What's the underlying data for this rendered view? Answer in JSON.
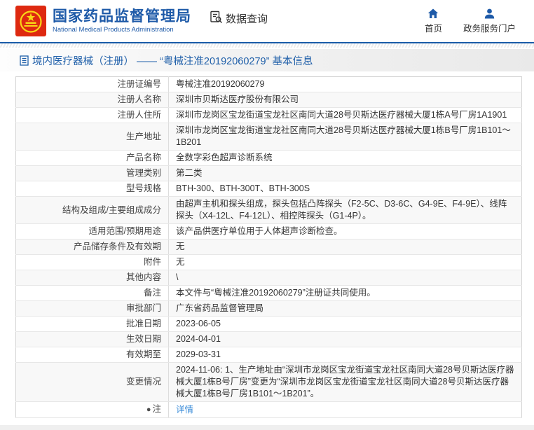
{
  "header": {
    "agency_name_zh": "国家药品监督管理局",
    "agency_name_en": "National Medical Products Administration",
    "data_query_label": "数据查询",
    "nav_home": "首页",
    "nav_portal": "政务服务门户"
  },
  "page_title": "境内医疗器械（注册） —— “粤械注准20192060279” 基本信息",
  "colors": {
    "brand_blue": "#1e5aa8",
    "link_blue": "#3c8dd9",
    "logo_red": "#de2910",
    "logo_gold": "#f9d616"
  },
  "table": {
    "rows": [
      {
        "label": "注册证编号",
        "value": "粤械注准20192060279"
      },
      {
        "label": "注册人名称",
        "value": "深圳市贝斯达医疗股份有限公司"
      },
      {
        "label": "注册人住所",
        "value": "深圳市龙岗区宝龙街道宝龙社区南同大道28号贝斯达医疗器械大厦1栋A号厂房1A1901"
      },
      {
        "label": "生产地址",
        "value": "深圳市龙岗区宝龙街道宝龙社区南同大道28号贝斯达医疗器械大厦1栋B号厂房1B101～1B201"
      },
      {
        "label": "产品名称",
        "value": "全数字彩色超声诊断系统"
      },
      {
        "label": "管理类别",
        "value": "第二类"
      },
      {
        "label": "型号规格",
        "value": "BTH-300、BTH-300T、BTH-300S"
      },
      {
        "label": "结构及组成/主要组成成分",
        "value": "由超声主机和探头组成，探头包括凸阵探头（F2-5C、D3-6C、G4-9E、F4-9E）、线阵探头（X4-12L、F4-12L）、相控阵探头（G1-4P）。"
      },
      {
        "label": "适用范围/预期用途",
        "value": "该产品供医疗单位用于人体超声诊断检查。"
      },
      {
        "label": "产品储存条件及有效期",
        "value": "无"
      },
      {
        "label": "附件",
        "value": "无"
      },
      {
        "label": "其他内容",
        "value": "\\"
      },
      {
        "label": "备注",
        "value": "本文件与“粤械注准20192060279”注册证共同使用。"
      },
      {
        "label": "审批部门",
        "value": "广东省药品监督管理局"
      },
      {
        "label": "批准日期",
        "value": "2023-06-05"
      },
      {
        "label": "生效日期",
        "value": "2024-04-01"
      },
      {
        "label": "有效期至",
        "value": "2029-03-31"
      },
      {
        "label": "变更情况",
        "value": "2024-11-06: 1、生产地址由“深圳市龙岗区宝龙街道宝龙社区南同大道28号贝斯达医疗器械大厦1栋B号厂房”变更为“深圳市龙岗区宝龙街道宝龙社区南同大道28号贝斯达医疗器械大厦1栋B号厂房1B101～1B201”。"
      },
      {
        "label": "注",
        "value": "详情",
        "link": true,
        "label_icon": "note-icon"
      }
    ]
  }
}
